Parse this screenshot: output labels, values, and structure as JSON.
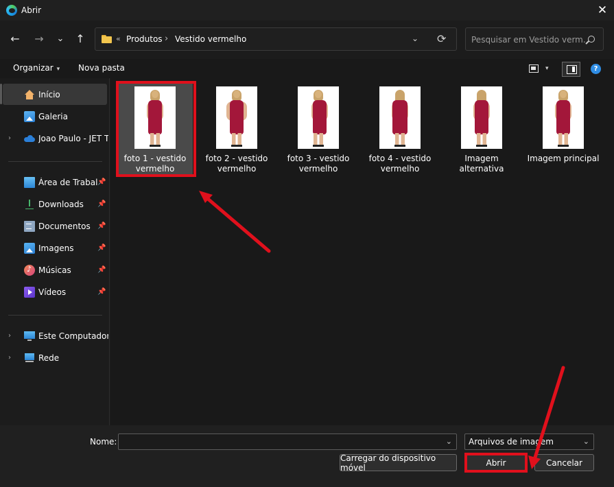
{
  "window": {
    "title": "Abrir",
    "app_icon": "edge-browser-icon",
    "close_glyph": "✕"
  },
  "nav": {
    "back_glyph": "←",
    "forward_glyph": "→",
    "recent_glyph": "⌄",
    "up_glyph": "↑"
  },
  "address": {
    "overflow_glyph": "«",
    "separator_glyph": "›",
    "crumbs": [
      "Produtos",
      "Vestido vermelho"
    ],
    "dropdown_glyph": "⌄",
    "refresh_glyph": "⟳"
  },
  "search": {
    "placeholder": "Pesquisar em Vestido verm..."
  },
  "toolbar": {
    "organize_label": "Organizar",
    "new_folder_label": "Nova pasta",
    "caret_glyph": "▾",
    "help_glyph": "?"
  },
  "sidebar": {
    "pin_glyph": "📌",
    "expand_glyph": "›",
    "items": [
      {
        "label": "Início",
        "icon": "home-icon"
      },
      {
        "label": "Galeria",
        "icon": "gallery-icon"
      },
      {
        "label": "Joao Paulo - JET TEC",
        "icon": "onedrive-cloud-icon"
      },
      {
        "label": "Área de Trabalho",
        "icon": "desktop-icon"
      },
      {
        "label": "Downloads",
        "icon": "download-icon"
      },
      {
        "label": "Documentos",
        "icon": "documents-icon"
      },
      {
        "label": "Imagens",
        "icon": "images-icon"
      },
      {
        "label": "Músicas",
        "icon": "music-icon"
      },
      {
        "label": "Vídeos",
        "icon": "videos-icon"
      },
      {
        "label": "Este Computador",
        "icon": "computer-icon"
      },
      {
        "label": "Rede",
        "icon": "network-icon"
      }
    ]
  },
  "files": [
    {
      "label": "foto 1 - vestido vermelho"
    },
    {
      "label": "foto 2 - vestido vermelho"
    },
    {
      "label": "foto 3 - vestido vermelho"
    },
    {
      "label": "foto 4 - vestido vermelho"
    },
    {
      "label": "Imagem alternativa"
    },
    {
      "label": "Imagem principal"
    }
  ],
  "bottom": {
    "name_label": "Nome:",
    "name_value": "",
    "file_type": "Arquivos de imagem",
    "upload_label": "Carregar do dispositivo móvel",
    "open_label": "Abrir",
    "cancel_label": "Cancelar"
  },
  "colors": {
    "annotation_red": "#e0101c",
    "dress_red": "#a3173a",
    "accent_blue": "#2f8de4"
  }
}
